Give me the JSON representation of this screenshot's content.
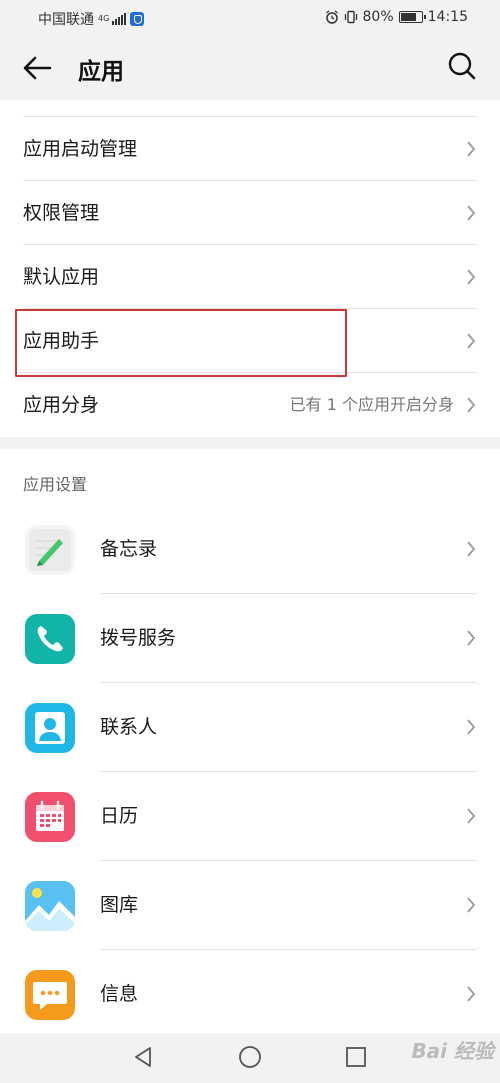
{
  "status_bar": {
    "carrier": "中国联通",
    "network": "4G",
    "battery": "80%",
    "time": "14:15"
  },
  "header": {
    "title": "应用",
    "back_icon": "back-arrow-icon",
    "search_icon": "search-icon"
  },
  "top_list": [
    {
      "label": "应用启动管理",
      "value": ""
    },
    {
      "label": "权限管理",
      "value": ""
    },
    {
      "label": "默认应用",
      "value": ""
    },
    {
      "label": "应用助手",
      "value": ""
    },
    {
      "label": "应用分身",
      "value": "已有 1 个应用开启分身"
    }
  ],
  "app_settings": {
    "section_title": "应用设置",
    "items": [
      {
        "label": "备忘录",
        "icon": "notepad-icon"
      },
      {
        "label": "拨号服务",
        "icon": "phone-icon"
      },
      {
        "label": "联系人",
        "icon": "contacts-icon"
      },
      {
        "label": "日历",
        "icon": "calendar-icon"
      },
      {
        "label": "图库",
        "icon": "gallery-icon"
      },
      {
        "label": "信息",
        "icon": "messages-icon"
      }
    ]
  },
  "colors": {
    "highlight": "#c83a3a",
    "phone": "#12b3a8",
    "contacts": "#1fb7e6",
    "calendar": "#f0506e",
    "gallery": "#2fa8e8",
    "messages": "#f59a1c"
  },
  "watermark": "Bai 经验"
}
